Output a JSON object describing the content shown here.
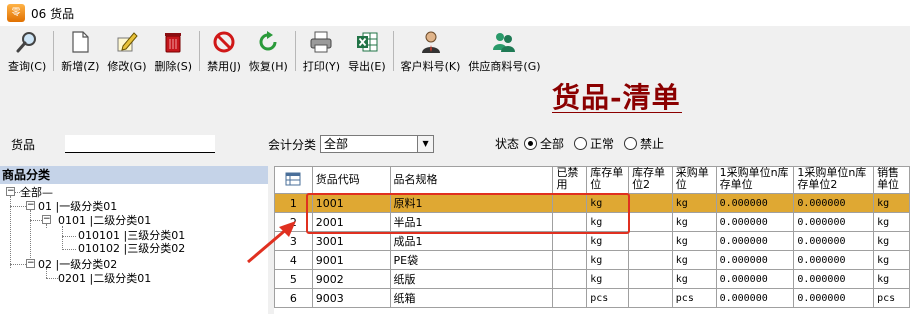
{
  "window": {
    "app_icon": "零一助手",
    "title": "06 货品"
  },
  "toolbar": {
    "buttons": [
      {
        "id": "query",
        "label": "查询(C)",
        "icon": "magnifier-icon"
      },
      {
        "id": "new",
        "label": "新增(Z)",
        "icon": "new-doc-icon"
      },
      {
        "id": "edit",
        "label": "修改(G)",
        "icon": "edit-pencil-icon"
      },
      {
        "id": "delete",
        "label": "删除(S)",
        "icon": "trash-icon"
      },
      {
        "id": "disable",
        "label": "禁用(J)",
        "icon": "ban-icon"
      },
      {
        "id": "restore",
        "label": "恢复(H)",
        "icon": "refresh-icon"
      },
      {
        "id": "print",
        "label": "打印(Y)",
        "icon": "printer-icon"
      },
      {
        "id": "export",
        "label": "导出(E)",
        "icon": "excel-icon"
      },
      {
        "id": "cust_no",
        "label": "客户料号(K)",
        "icon": "person-icon"
      },
      {
        "id": "supp_no",
        "label": "供应商料号(G)",
        "icon": "group-icon"
      }
    ]
  },
  "page_title": "货品-清单",
  "filters": {
    "goods_label": "货品",
    "goods_value": "",
    "acct_label": "会计分类",
    "acct_value": "全部",
    "status_label": "状态",
    "status_options": [
      "全部",
      "正常",
      "禁止"
    ],
    "status_selected": "全部"
  },
  "category": {
    "header": "商品分类",
    "nodes": {
      "root": "全部",
      "n01": "01 |一级分类01",
      "n0101": "0101 |二级分类01",
      "n010101": "010101 |三级分类01",
      "n010102": "010102 |三级分类02",
      "n02": "02 |一级分类02",
      "n0201": "0201 |二级分类01"
    }
  },
  "grid": {
    "headers": {
      "code": "货品代码",
      "name": "品名规格",
      "disabled": "已禁用",
      "stock_unit": "库存单位",
      "stock_unit2": "库存单位2",
      "purchase_unit": "采购单位",
      "rate1": "1采购单位n库存单位",
      "rate2": "1采购单位n库存单位2",
      "sales_unit": "销售单位"
    },
    "rows": [
      {
        "no": "1",
        "code": "1001",
        "name": "原料1",
        "stock_unit": "kg",
        "purchase_unit": "kg",
        "rate1": "0.000000",
        "rate2": "0.000000",
        "sales_unit": "kg"
      },
      {
        "no": "2",
        "code": "2001",
        "name": "半品1",
        "stock_unit": "kg",
        "purchase_unit": "kg",
        "rate1": "0.000000",
        "rate2": "0.000000",
        "sales_unit": "kg"
      },
      {
        "no": "3",
        "code": "3001",
        "name": "成品1",
        "stock_unit": "kg",
        "purchase_unit": "kg",
        "rate1": "0.000000",
        "rate2": "0.000000",
        "sales_unit": "kg"
      },
      {
        "no": "4",
        "code": "9001",
        "name": "PE袋",
        "stock_unit": "kg",
        "purchase_unit": "kg",
        "rate1": "0.000000",
        "rate2": "0.000000",
        "sales_unit": "kg"
      },
      {
        "no": "5",
        "code": "9002",
        "name": "纸版",
        "stock_unit": "kg",
        "purchase_unit": "kg",
        "rate1": "0.000000",
        "rate2": "0.000000",
        "sales_unit": "kg"
      },
      {
        "no": "6",
        "code": "9003",
        "name": "纸箱",
        "stock_unit": "pcs",
        "purchase_unit": "pcs",
        "rate1": "0.000000",
        "rate2": "0.000000",
        "sales_unit": "pcs"
      }
    ],
    "selected_row": "1"
  },
  "colors": {
    "selected_row": "#dfa833",
    "title_red": "#8b0000",
    "annotation_red": "#e03020",
    "category_header": "#c5d3e8"
  }
}
